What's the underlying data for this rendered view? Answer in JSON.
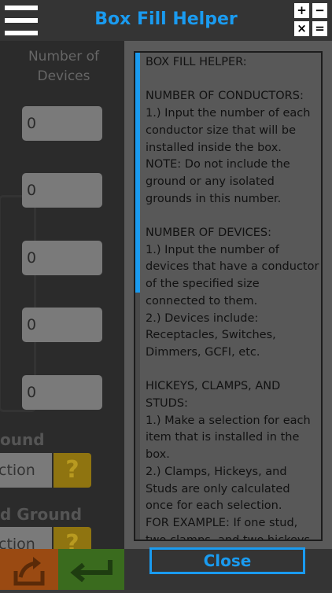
{
  "header": {
    "title": "Box Fill Helper",
    "menu_icon": "hamburger-menu-icon",
    "calc_icon": {
      "name": "calculator-icon",
      "keys": [
        "+",
        "−",
        "×",
        "="
      ]
    },
    "title_color": "#1a9bf0"
  },
  "left_panel": {
    "column_header": "Number of\nDevices",
    "inputs": [
      {
        "value": "0"
      },
      {
        "value": "0"
      },
      {
        "value": "0"
      },
      {
        "value": "0"
      },
      {
        "value": "0"
      }
    ],
    "sections": [
      {
        "label": "ound",
        "selection": "ction",
        "help": "?"
      },
      {
        "label": "d Ground",
        "selection": "ction",
        "help": "?"
      }
    ]
  },
  "help_text": "BOX FILL HELPER:\n\nNUMBER OF CONDUCTORS:\n1.) Input the number of each conductor size that will be installed inside the box.\nNOTE: Do not include the ground or any isolated grounds in this number.\n\nNUMBER OF DEVICES:\n1.) Input the number of devices that have a conductor of the specified size connected to them.\n2.) Devices include: Receptacles, Switches, Dimmers, GCFI, etc.\n\nHICKEYS, CLAMPS, AND STUDS:\n1.) Make a selection for each item that is installed in the box.\n2.) Clamps, Hickeys, and Studs are only calculated once for each selection.\nFOR EXAMPLE: If one stud, two clamps, and two hickeys",
  "bottom": {
    "share_icon": "share-icon",
    "enter_icon": "return-arrow-icon",
    "close_label": "Close"
  },
  "colors": {
    "accent": "#1a9bf0",
    "share": "#9a4a12",
    "enter": "#3a6b1e",
    "help": "#8f7410"
  }
}
